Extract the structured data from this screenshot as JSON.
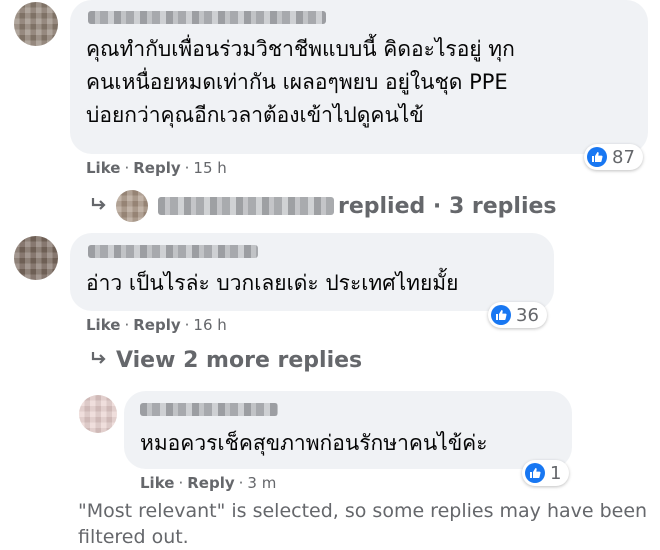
{
  "comments": [
    {
      "text": "คุณทำกับเพื่อนร่วมวิชาชีพแบบนี้ คิดอะไรอยู่ ทุก\nคนเหนื่อยหมดเท่ากัน เผลอๆพยบ อยู่ในชุด PPE\nบ่อยกว่าคุณอีกเวลาต้องเข้าไปดูคนไข้",
      "like_label": "Like",
      "reply_label": "Reply",
      "time": "15 h",
      "reactions": "87",
      "replies_summary": "replied · 3 replies"
    },
    {
      "text": "อ่าว เป็นไรล่ะ บวกเลยเด่ะ ประเทศไทยมั้ย",
      "like_label": "Like",
      "reply_label": "Reply",
      "time": "16 h",
      "reactions": "36",
      "more_replies": "View 2 more replies"
    }
  ],
  "reply": {
    "text": "หมอควรเช็คสุขภาพก่อนรักษาคนไข้ค่ะ",
    "like_label": "Like",
    "reply_label": "Reply",
    "time": "3 m",
    "reactions": "1"
  },
  "footer_notice": "\"Most relevant\" is selected, so some replies may have been filtered out.",
  "icons": {
    "reaction": "like-thumb-icon",
    "reply_arrow": "reply-arrow-icon"
  },
  "colors": {
    "like_blue": "#1877f2",
    "bubble": "#f0f2f5",
    "meta_text": "#65676b"
  }
}
